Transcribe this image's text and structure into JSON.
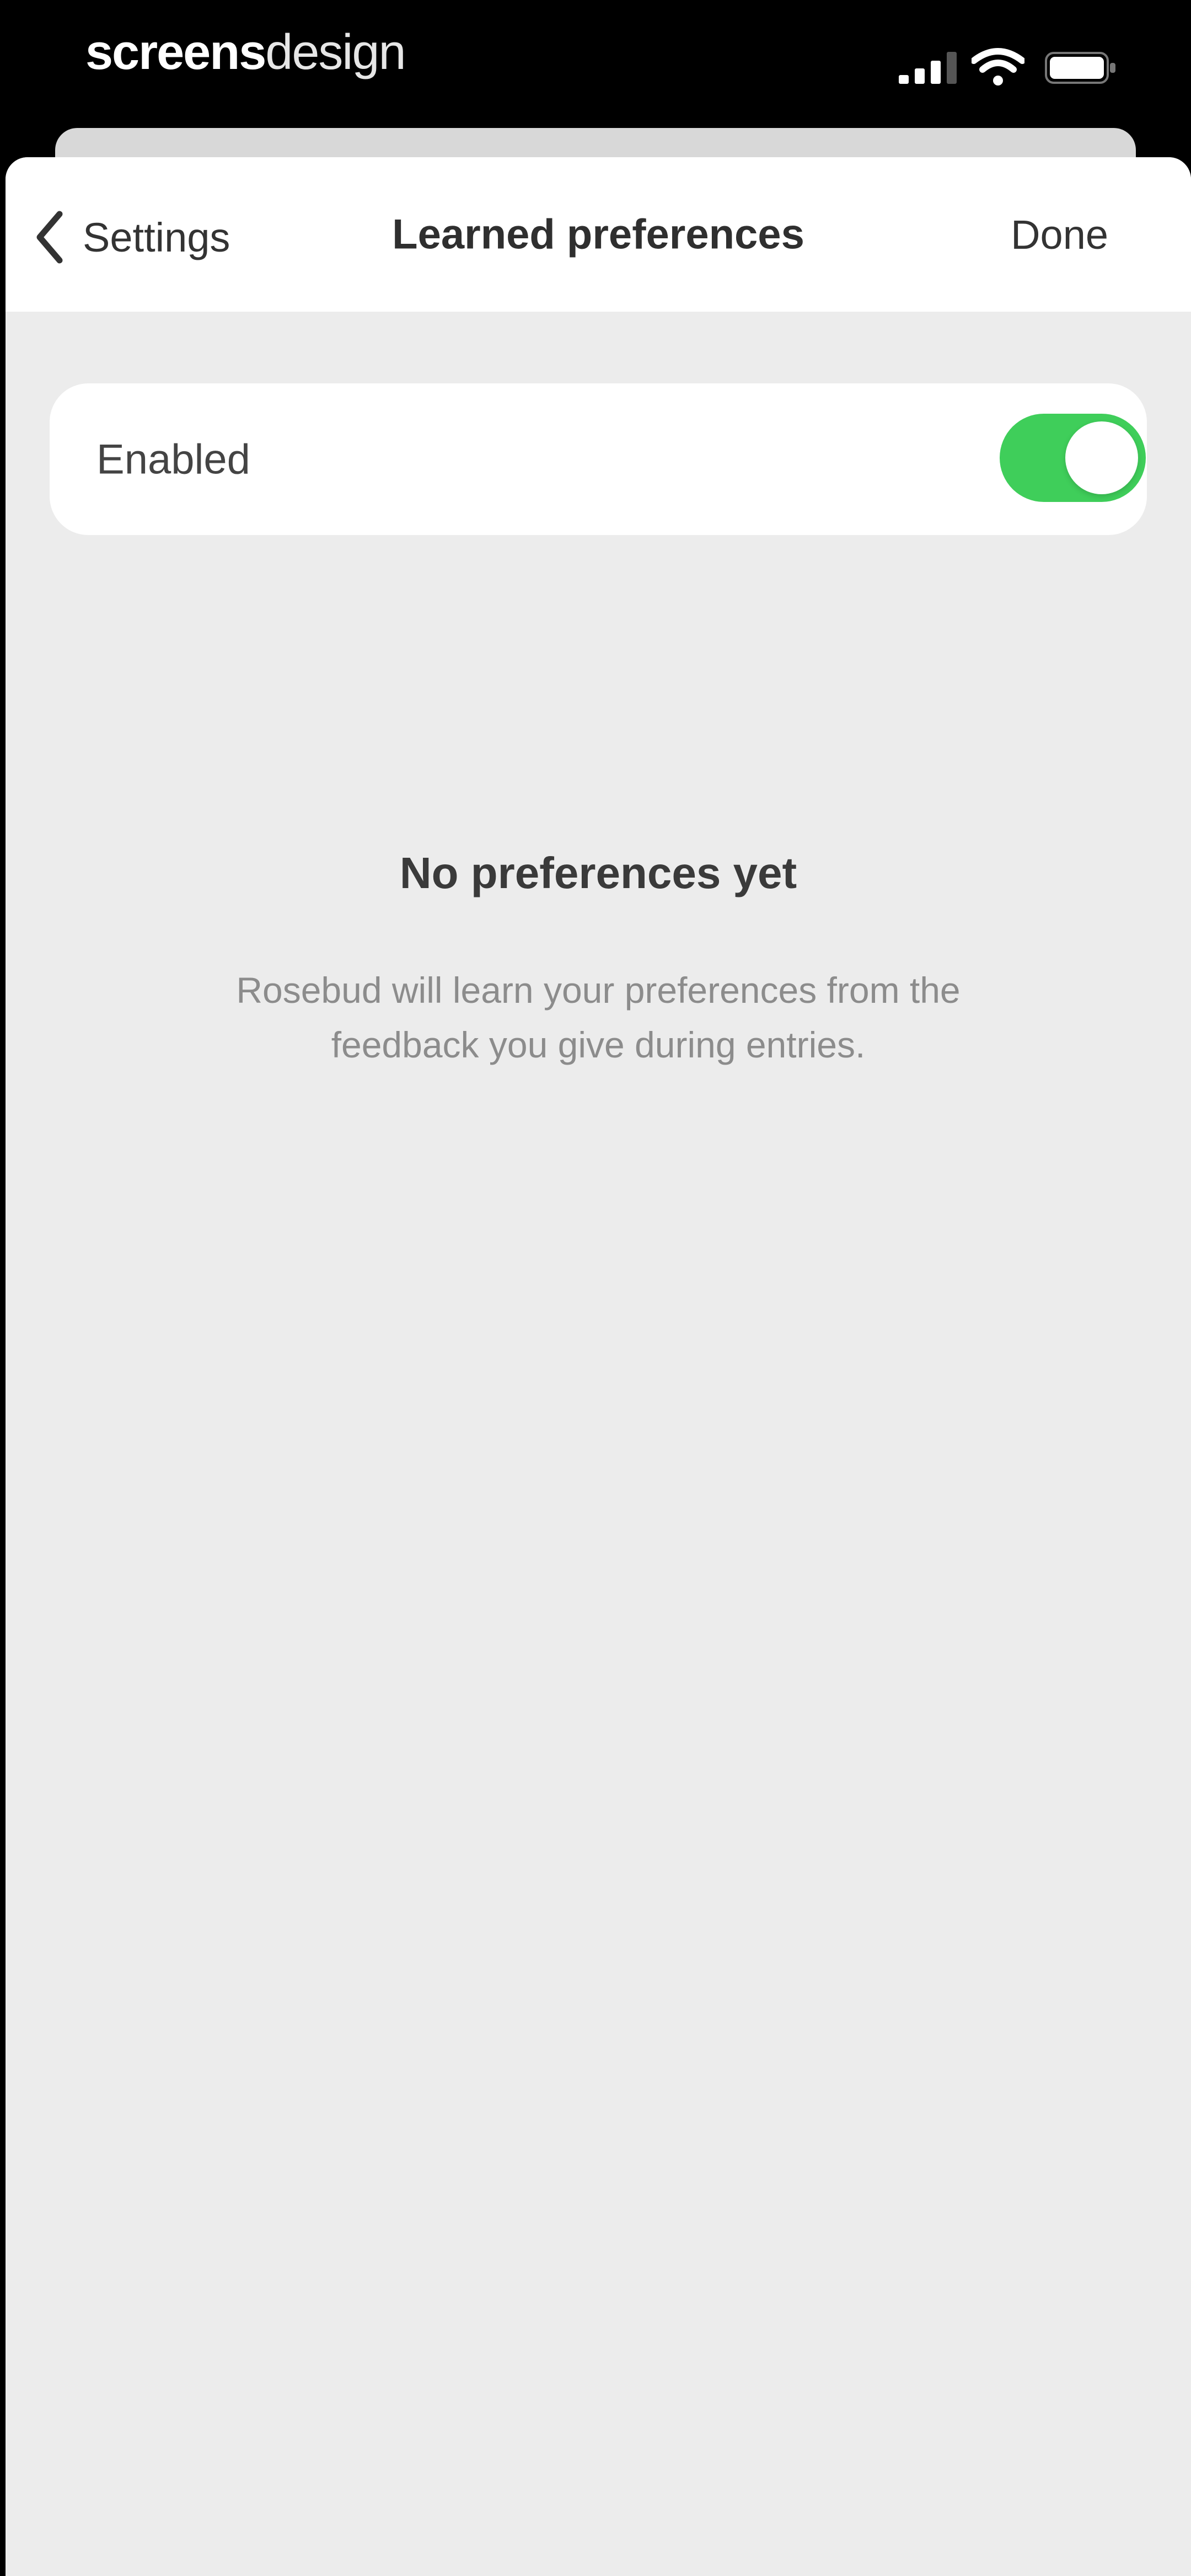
{
  "status_bar": {
    "brand_strong": "screens",
    "brand_light": "design",
    "signal_icon": "cellular-signal-icon",
    "wifi_icon": "wifi-icon",
    "battery_icon": "battery-icon"
  },
  "nav": {
    "back_label": "Settings",
    "back_icon": "chevron-left-icon",
    "title": "Learned preferences",
    "done_label": "Done"
  },
  "toggle": {
    "label": "Enabled",
    "on": true,
    "on_color": "#3fce5a"
  },
  "empty_state": {
    "title": "No preferences yet",
    "body": "Rosebud will learn your preferences from the feedback you give during entries."
  }
}
